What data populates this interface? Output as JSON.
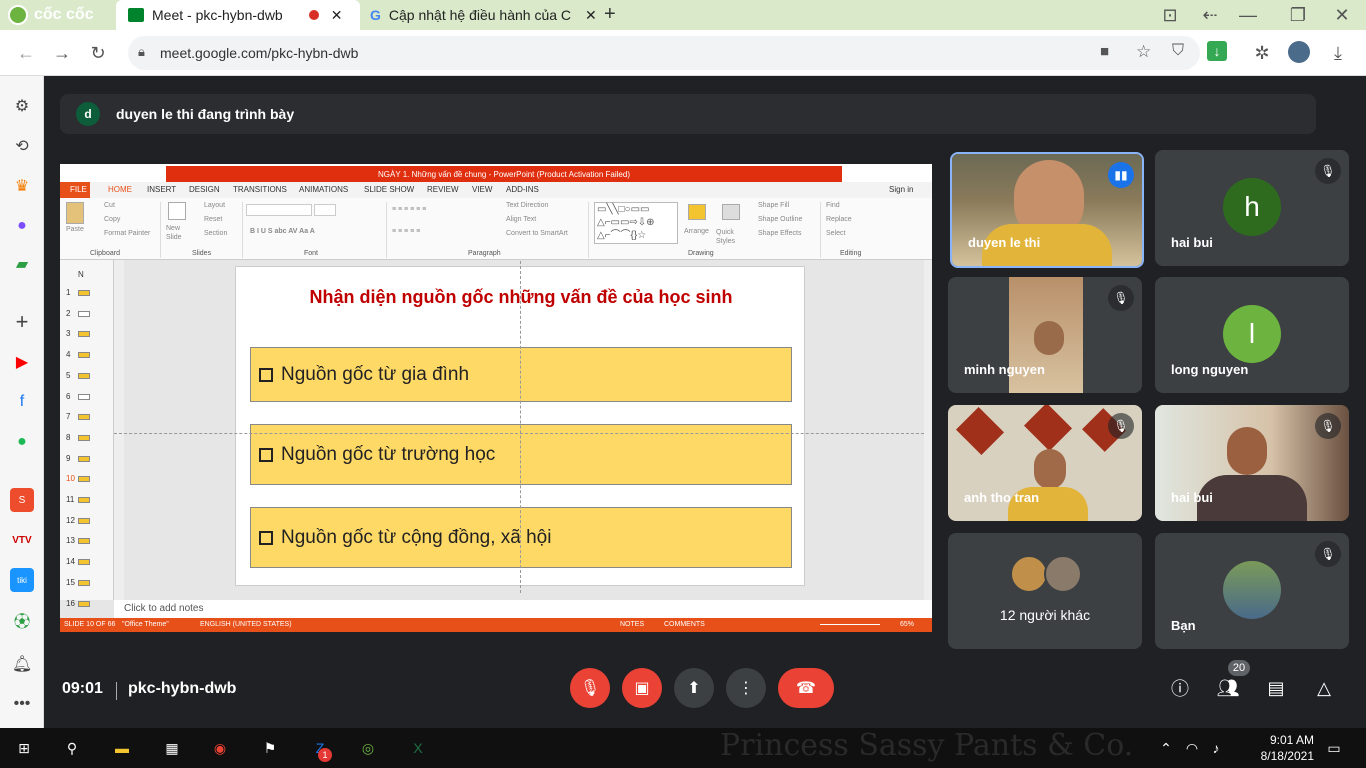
{
  "browser": {
    "brand": "cốc cốc",
    "tabs": [
      {
        "label": "Meet - pkc-hybn-dwb",
        "active": true
      },
      {
        "label": "Cập nhật hệ điều hành của C",
        "active": false
      }
    ],
    "url": "meet.google.com/pkc-hybn-dwb",
    "new_tab_label": "+"
  },
  "presenter": {
    "initial": "d",
    "text": "duyen le thi đang trình bày"
  },
  "ppt": {
    "title": "NGÀY 1. Những vấn đề chung - PowerPoint (Product Activation Failed)",
    "menu": [
      "FILE",
      "HOME",
      "INSERT",
      "DESIGN",
      "TRANSITIONS",
      "ANIMATIONS",
      "SLIDE SHOW",
      "REVIEW",
      "VIEW",
      "ADD-INS"
    ],
    "sign_in": "Sign in",
    "ribbon": {
      "paste": "Paste",
      "cut": "Cut",
      "copy": "Copy",
      "format_painter": "Format Painter",
      "new_slide": "New Slide",
      "layout": "Layout",
      "reset": "Reset",
      "section": "Section",
      "text_direction": "Text Direction",
      "align_text": "Align Text",
      "convert_smartart": "Convert to SmartArt",
      "arrange": "Arrange",
      "quick_styles": "Quick Styles",
      "shape_fill": "Shape Fill",
      "shape_outline": "Shape Outline",
      "shape_effects": "Shape Effects",
      "find": "Find",
      "replace": "Replace",
      "select": "Select",
      "groups": [
        "Clipboard",
        "Slides",
        "Font",
        "Paragraph",
        "Drawing",
        "Editing"
      ]
    },
    "thumbs": [
      "1",
      "2",
      "3",
      "4",
      "5",
      "6",
      "7",
      "8",
      "9",
      "10",
      "11",
      "12",
      "13",
      "14",
      "15",
      "16"
    ],
    "thumbs_header": "N",
    "slide_title": "Nhận diện nguồn gốc những vấn đề của học sinh",
    "boxes": [
      "Nguồn gốc từ gia đình",
      "Nguồn gốc từ trường học",
      "Nguồn gốc từ cộng đồng, xã hội"
    ],
    "notes": "Click to add notes",
    "status": {
      "slide": "SLIDE 10 OF 66",
      "theme": "\"Office Theme\"",
      "lang": "ENGLISH (UNITED STATES)",
      "notes": "NOTES",
      "comments": "COMMENTS",
      "zoom": "65%"
    }
  },
  "participants": [
    {
      "name": "duyen le thi",
      "type": "video",
      "speaking": true
    },
    {
      "name": "hai bui",
      "type": "avatar",
      "initial": "h",
      "color": "#2e6b1f",
      "muted": true
    },
    {
      "name": "minh nguyen",
      "type": "video",
      "muted": true
    },
    {
      "name": "long nguyen",
      "type": "avatar",
      "initial": "l",
      "color": "#6cb33f",
      "muted": false
    },
    {
      "name": "anh tho tran",
      "type": "video",
      "muted": true
    },
    {
      "name": "hai bui",
      "type": "video",
      "muted": true
    },
    {
      "name": "12 người khác",
      "type": "group"
    },
    {
      "name": "Bạn",
      "type": "self",
      "muted": true
    }
  ],
  "controls": {
    "time": "09:01",
    "code": "pkc-hybn-dwb",
    "participant_count": "20"
  },
  "taskbar": {
    "time": "9:01 AM",
    "date": "8/18/2021",
    "zalo_badge": "1",
    "watermark": "Princess Sassy Pants & Co."
  },
  "colors": {
    "accent_red": "#ea4335",
    "slide_box": "#ffd966",
    "slide_title": "#c00000",
    "ppt_orange": "#e8501a"
  }
}
